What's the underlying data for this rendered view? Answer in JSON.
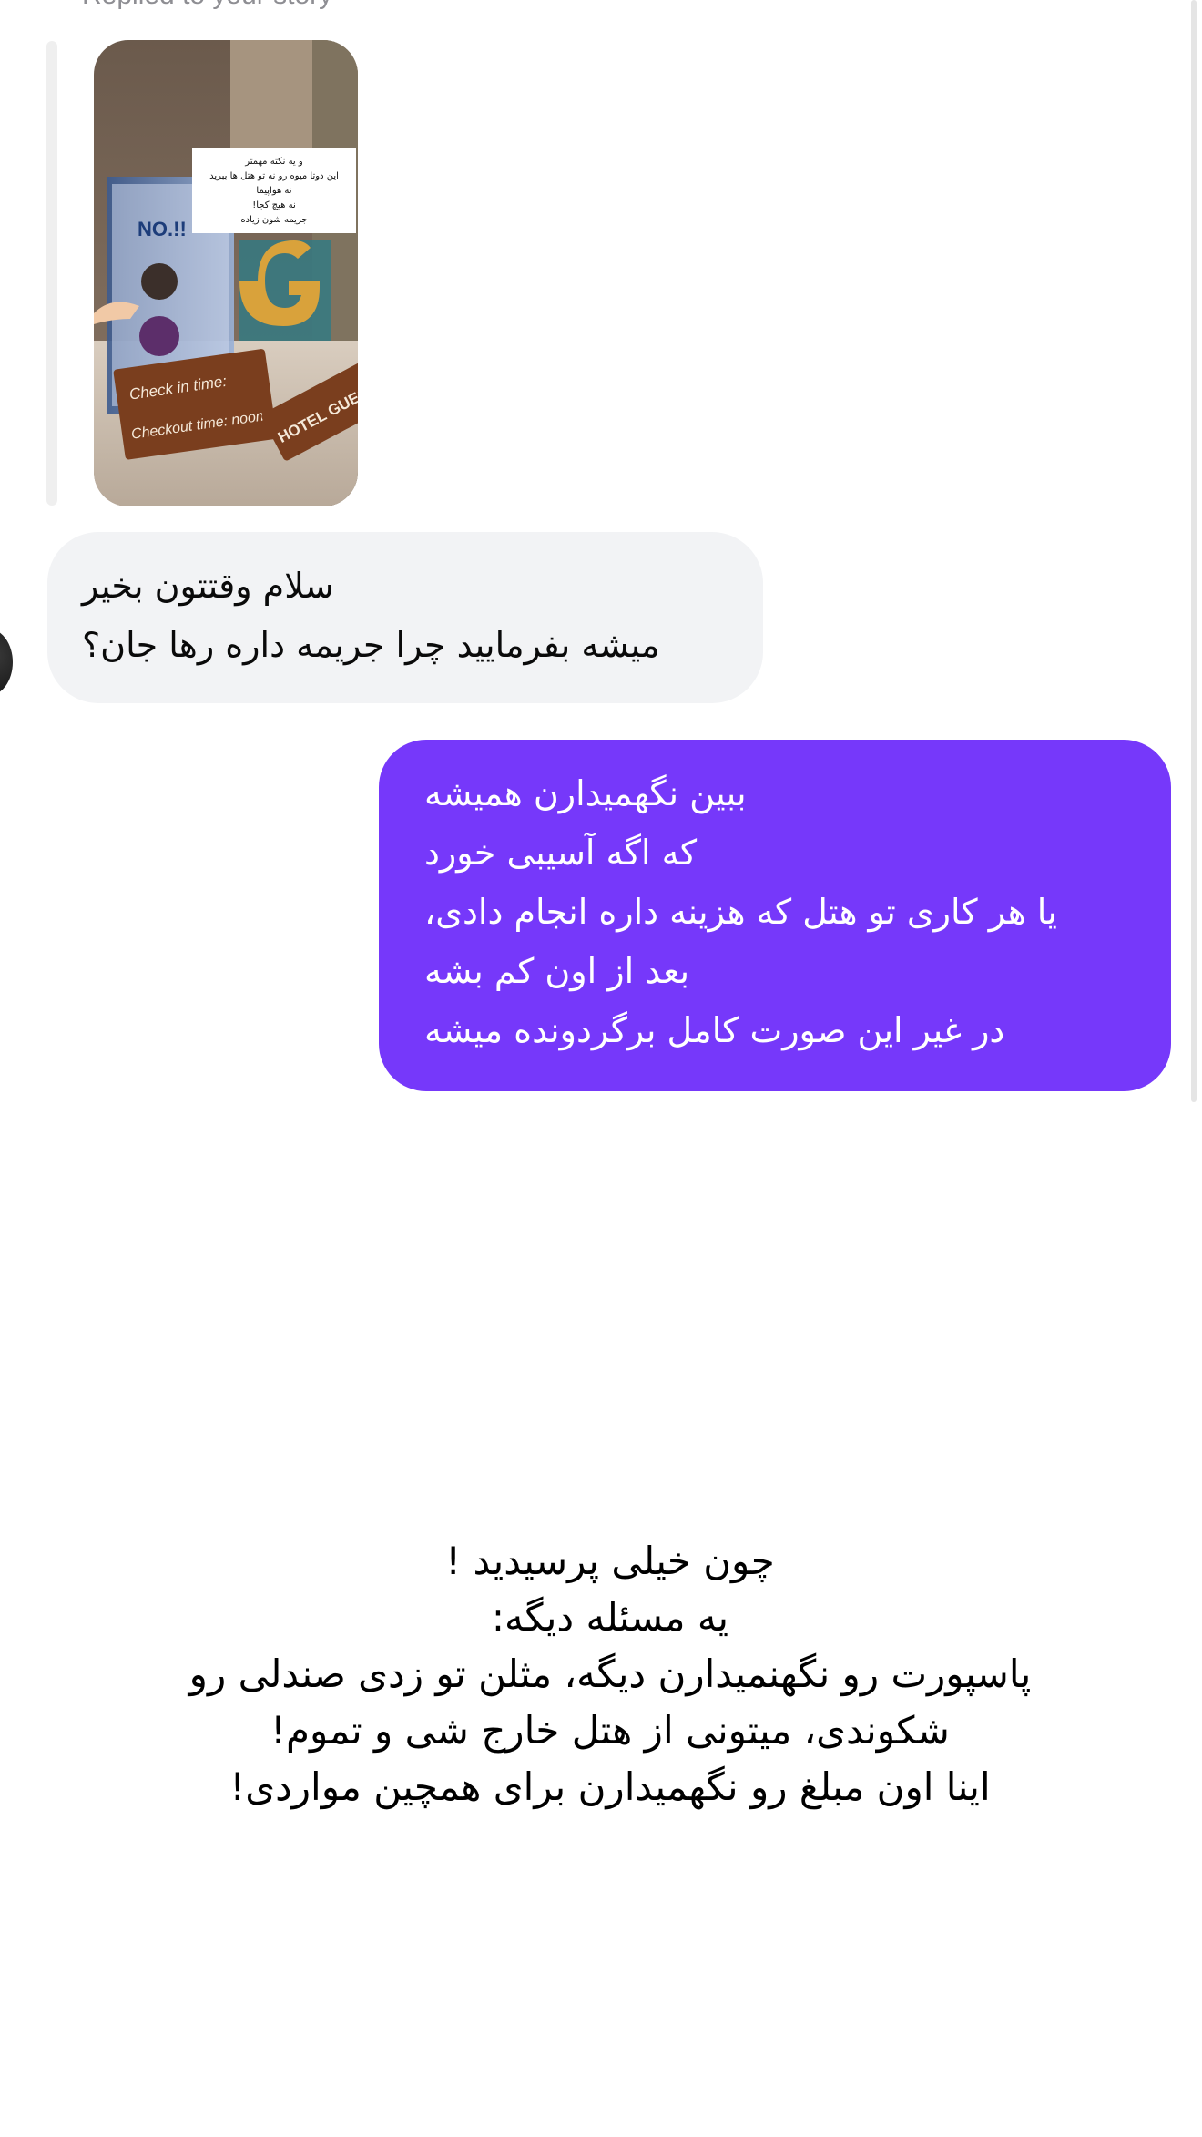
{
  "reply_context": {
    "label": "Replied to your story",
    "story_sticker_lines": [
      "و یه نکته مهمتر",
      "این دوتا میوه رو نه تو هتل ها ببرید",
      "نه هواپیما",
      "نه هیچ کجا!",
      "جریمه شون زیاده"
    ],
    "story_sign_no": "NO.!!",
    "story_sign_checkin": "Check in time:",
    "story_sign_checkout": "Checkout time: noon",
    "story_sign_hotel": "HOTEL GUESTS"
  },
  "incoming_message": {
    "lines": [
      "سلام وقتتون بخیر",
      "میشه بفرمایید چرا جریمه داره رها جان؟"
    ]
  },
  "outgoing_message": {
    "lines": [
      "ببین نگهمیدارن همیشه",
      "که اگه آسیبی خورد",
      "یا هر کاری تو هتل که هزینه داره انجام دادی،",
      "بعد از اون کم بشه",
      "در غیر این صورت کامل برگردونده میشه"
    ]
  },
  "caption": {
    "lines": [
      "چون خیلی پرسیدید !",
      "یه مسئله دیگه:",
      "پاسپورت رو نگهنمیدارن دیگه، مثلن تو زدی صندلی رو",
      "شکوندی، میتونی از هتل خارج شی و تموم!",
      "اینا اون مبلغ رو نگهمیدارن برای همچین مواردی!"
    ]
  },
  "colors": {
    "outgoing_bubble": "#7638fa",
    "incoming_bubble": "#f2f3f5",
    "muted_text": "#8e8e93"
  }
}
